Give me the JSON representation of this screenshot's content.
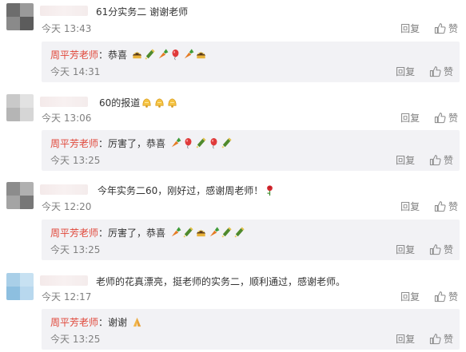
{
  "labels": {
    "reply": "回复",
    "like": "赞"
  },
  "comments": [
    {
      "text": "61分实务二 谢谢老师",
      "time": "今天 13:43",
      "reply": {
        "author": "周平芳老师",
        "text": "：恭喜",
        "time": "今天 14:31",
        "emojis": [
          "cake",
          "bottle",
          "carrot",
          "balloon",
          "carrot",
          "cake"
        ]
      }
    },
    {
      "text": "60的报道",
      "time": "今天 13:06",
      "emojis": [
        "bell",
        "bell",
        "bell"
      ],
      "reply": {
        "author": "周平芳老师",
        "text": "：厉害了，恭喜",
        "time": "今天 13:25",
        "emojis": [
          "carrot",
          "balloon",
          "bottle",
          "balloon",
          "bottle"
        ]
      }
    },
    {
      "text": "今年实务二60，刚好过，感谢周老师！",
      "time": "今天 12:20",
      "emojis": [
        "rose"
      ],
      "reply": {
        "author": "周平芳老师",
        "text": "：厉害了，恭喜",
        "time": "今天 13:25",
        "emojis": [
          "carrot",
          "bottle",
          "cake",
          "carrot",
          "bottle",
          "bottle"
        ]
      }
    },
    {
      "text": "老师的花真漂亮，挺老师的实务二，顺利通过，感谢老师。",
      "time": "今天 12:17",
      "reply": {
        "author": "周平芳老师",
        "text": "：谢谢",
        "time": "今天 13:25",
        "emojis": [
          "pray"
        ]
      }
    }
  ]
}
